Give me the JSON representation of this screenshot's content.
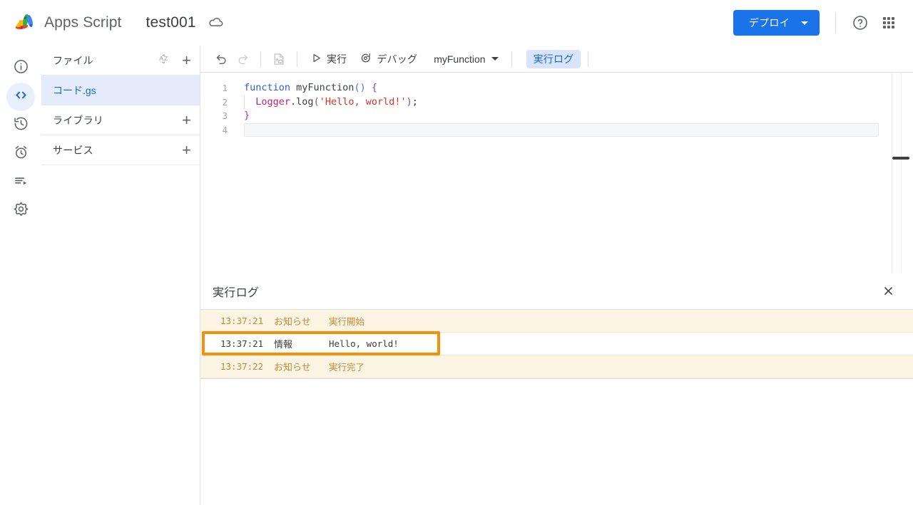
{
  "topbar": {
    "logo_icon": "apps-script-logo",
    "brand": "Apps Script",
    "project_title": "test001",
    "cloud_icon": "cloud-icon",
    "deploy_label": "デプロイ",
    "help_icon": "help-circle-icon",
    "apps_icon": "apps-grid-icon"
  },
  "rail": {
    "items": [
      {
        "icon": "info-circle-icon",
        "name": "overview",
        "active": false
      },
      {
        "icon": "code-brackets-icon",
        "name": "editor",
        "active": true
      },
      {
        "icon": "history-clock-icon",
        "name": "versions",
        "active": false
      },
      {
        "icon": "alarm-clock-icon",
        "name": "triggers",
        "active": false
      },
      {
        "icon": "executions-list-icon",
        "name": "executions",
        "active": false
      },
      {
        "icon": "gear-icon",
        "name": "settings",
        "active": false
      }
    ]
  },
  "file_panel": {
    "sections": [
      {
        "label": "ファイル",
        "sort_icon": "sort-alpha-icon",
        "add_icon": "plus-icon"
      },
      {
        "label": "ライブラリ",
        "sort_icon": "",
        "add_icon": "plus-icon"
      },
      {
        "label": "サービス",
        "sort_icon": "",
        "add_icon": "plus-icon"
      }
    ],
    "files": [
      {
        "name": "コード.gs",
        "selected": true
      }
    ]
  },
  "editor_toolbar": {
    "undo_icon": "undo-arrow-icon",
    "redo_icon": "redo-arrow-icon",
    "save_icon": "save-project-icon",
    "run_icon": "play-triangle-icon",
    "run_label": "実行",
    "debug_icon": "debug-bug-icon",
    "debug_label": "デバッグ",
    "function_select": "myFunction",
    "function_caret": "chevron-down-icon",
    "log_tab_label": "実行ログ"
  },
  "code": {
    "lines": [
      {
        "no": "1",
        "tokens": [
          {
            "t": "function ",
            "c": "k-blue"
          },
          {
            "t": "myFunction",
            "c": "k-dark"
          },
          {
            "t": "()",
            "c": "k-paren"
          },
          {
            "t": " ",
            "c": "k-dark"
          },
          {
            "t": "{",
            "c": "k-purple"
          }
        ]
      },
      {
        "no": "2",
        "indent": true,
        "tokens": [
          {
            "t": "  ",
            "c": "k-dark"
          },
          {
            "t": "Logger",
            "c": "k-pink"
          },
          {
            "t": ".log",
            "c": "k-dark"
          },
          {
            "t": "(",
            "c": "k-purple"
          },
          {
            "t": "'Hello, world!'",
            "c": "k-red"
          },
          {
            "t": ")",
            "c": "k-purple"
          },
          {
            "t": ";",
            "c": "k-dark"
          }
        ]
      },
      {
        "no": "3",
        "tokens": [
          {
            "t": "}",
            "c": "k-purple"
          }
        ]
      },
      {
        "no": "4",
        "active": true,
        "tokens": []
      }
    ]
  },
  "log_panel": {
    "title": "実行ログ",
    "close_icon": "close-x-icon",
    "rows": [
      {
        "time": "13:37:21",
        "level": "お知らせ",
        "message": "実行開始",
        "highlight": false
      },
      {
        "time": "13:37:21",
        "level": "情報",
        "message": "Hello, world!",
        "highlight": true
      },
      {
        "time": "13:37:22",
        "level": "お知らせ",
        "message": "実行完了",
        "highlight": false
      }
    ]
  },
  "colors": {
    "accent_blue": "#1a73e8",
    "active_rail": "#e8f0fe",
    "file_selected": "#e4ebfa",
    "log_row_bg": "#fdf5e3",
    "log_row_text": "#c8873c",
    "annotation_orange": "#f79009"
  }
}
